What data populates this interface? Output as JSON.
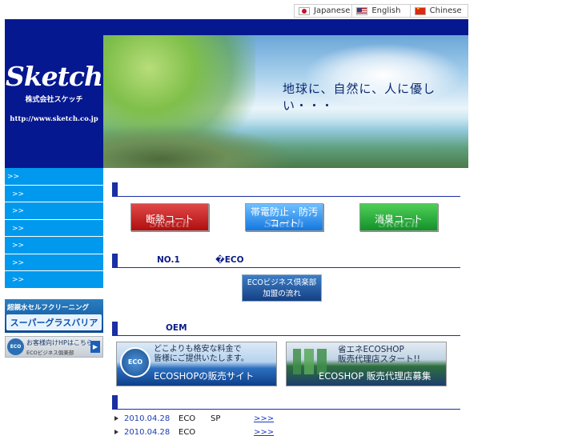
{
  "languages": [
    {
      "label": "Japanese",
      "flag": "jp-flag-icon"
    },
    {
      "label": "English",
      "flag": "us-flag-icon"
    },
    {
      "label": "Chinese",
      "flag": "cn-flag-icon"
    }
  ],
  "header": {
    "logo": "Sketch",
    "company": "株式会社スケッチ",
    "url": "http://www.sketch.co.jp",
    "tagline": "地球に、自然に、人に優しい・・・"
  },
  "nav": {
    "items": [
      ">>",
      ">>",
      ">>",
      ">>",
      ">>",
      ">>",
      ">>"
    ]
  },
  "sidebar_banners": {
    "superglass_top": "超親水セルフクリーニング",
    "superglass_main": "スーパーグラスバリア",
    "eco_circle": "ECO",
    "customer_main": "お客様向けHPはこちら",
    "customer_sub": "ECOビジネス倶楽部",
    "arrow": "▶"
  },
  "sections": {
    "products_title": "",
    "oem_left": "NO.1",
    "oem_right": "�ECO",
    "shops_title": "OEM",
    "news_title": ""
  },
  "products": [
    {
      "label": "断熱コート",
      "watermark": "Sketch"
    },
    {
      "label": "帯電防止・防汚\nコート",
      "watermark": "Sketch"
    },
    {
      "label": "消臭コート",
      "watermark": "Sketch"
    }
  ],
  "ecoclub": {
    "line1": "ECOビジネス倶楽部",
    "line2": "加盟の流れ"
  },
  "ecoshop": [
    {
      "eco": "ECO",
      "top": "どこよりも格安な料金で\n皆様にご提供いたします。",
      "bottom": "ECOSHOPの販売サイト"
    },
    {
      "eco": "ECO",
      "top": "省エネECOSHOP\n販売代理店スタート!!",
      "bottom": "ECOSHOP 販売代理店募集"
    }
  ],
  "news": [
    {
      "date": "2010.04.28",
      "cat": "ECO",
      "text": "SP",
      "more": ">>>"
    },
    {
      "date": "2010.04.28",
      "cat": "ECO",
      "text": "",
      "more": ">>>"
    }
  ],
  "colors": {
    "header_bg": "#06188f",
    "nav_bg": "#0099ee",
    "section_accent": "#1a2fa3"
  }
}
